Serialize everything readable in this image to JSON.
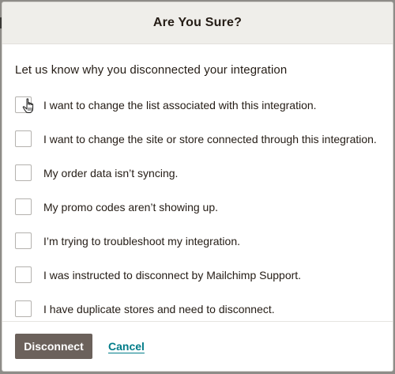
{
  "modal": {
    "title": "Are You Sure?",
    "question": "Let us know why you disconnected your integration",
    "options": [
      {
        "label": "I want to change the list associated with this integration.",
        "checked": false
      },
      {
        "label": "I want to change the site or store connected through this integration.",
        "checked": false
      },
      {
        "label": "My order data isn’t syncing.",
        "checked": false
      },
      {
        "label": "My promo codes aren’t showing up.",
        "checked": false
      },
      {
        "label": "I’m trying to troubleshoot my integration.",
        "checked": false
      },
      {
        "label": "I was instructed to disconnect by Mailchimp Support.",
        "checked": false
      },
      {
        "label": "I have duplicate stores and need to disconnect.",
        "checked": false
      }
    ],
    "footer": {
      "disconnect_label": "Disconnect",
      "cancel_label": "Cancel"
    }
  },
  "colors": {
    "backdrop": "#8e8c88",
    "header_bg": "#efeeea",
    "primary_button": "#6b615b",
    "link": "#007c89",
    "text": "#241c15"
  },
  "icons": {
    "cursor": "hand-pointer-icon"
  }
}
